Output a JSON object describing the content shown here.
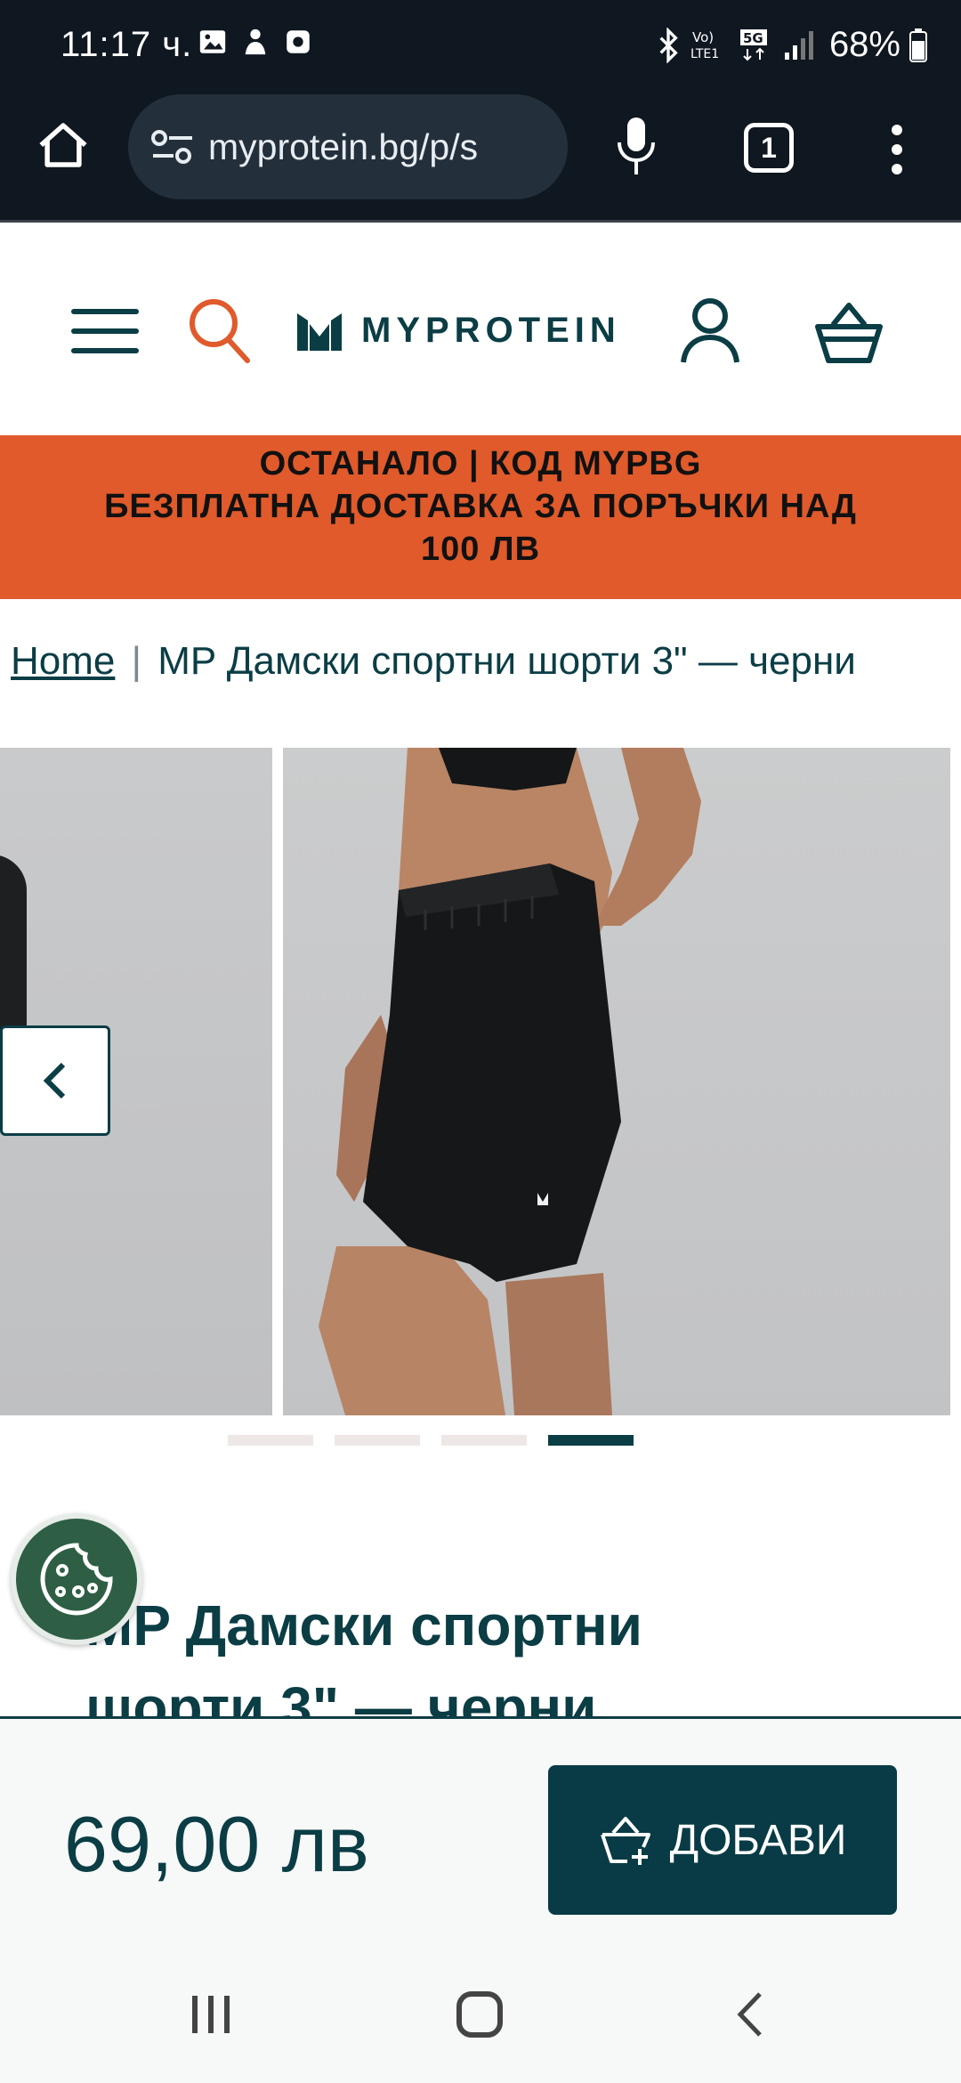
{
  "status_bar": {
    "time": "11:17 ч.",
    "battery": "68%"
  },
  "browser": {
    "url": "myprotein.bg/p/s",
    "tab_count": "1"
  },
  "header": {
    "logo_text": "MYPROTEIN"
  },
  "promo": {
    "line1": "ОСТАНАЛО | КОД MYPBG",
    "line2": "БЕЗПЛАТНА ДОСТАВКА ЗА ПОРЪЧКИ НАД",
    "line3": "100 ЛВ"
  },
  "breadcrumb": {
    "home": "Home",
    "separator": "|",
    "current": "MP Дамски спортни шорти 3\" — черни"
  },
  "gallery": {
    "slide_count": 4,
    "active_slide": 4
  },
  "product": {
    "title_line1": "MP Дамски спортни",
    "title_line2": "шорти 3\" — черни"
  },
  "sticky": {
    "price": "69,00 лв",
    "add_label": "ДОБАВИ"
  },
  "colors": {
    "brand_teal": "#0b3d45",
    "promo_orange": "#e05a2b",
    "browser_bg": "#0f1720",
    "cookie_green": "#2e5e44"
  },
  "icons": {
    "home": "home-icon",
    "site_settings": "tune-icon",
    "mic": "mic-icon",
    "menu": "more-vert-icon",
    "hamburger": "hamburger-icon",
    "search": "search-icon",
    "account": "account-icon",
    "basket": "basket-icon",
    "cookie": "cookie-icon"
  }
}
